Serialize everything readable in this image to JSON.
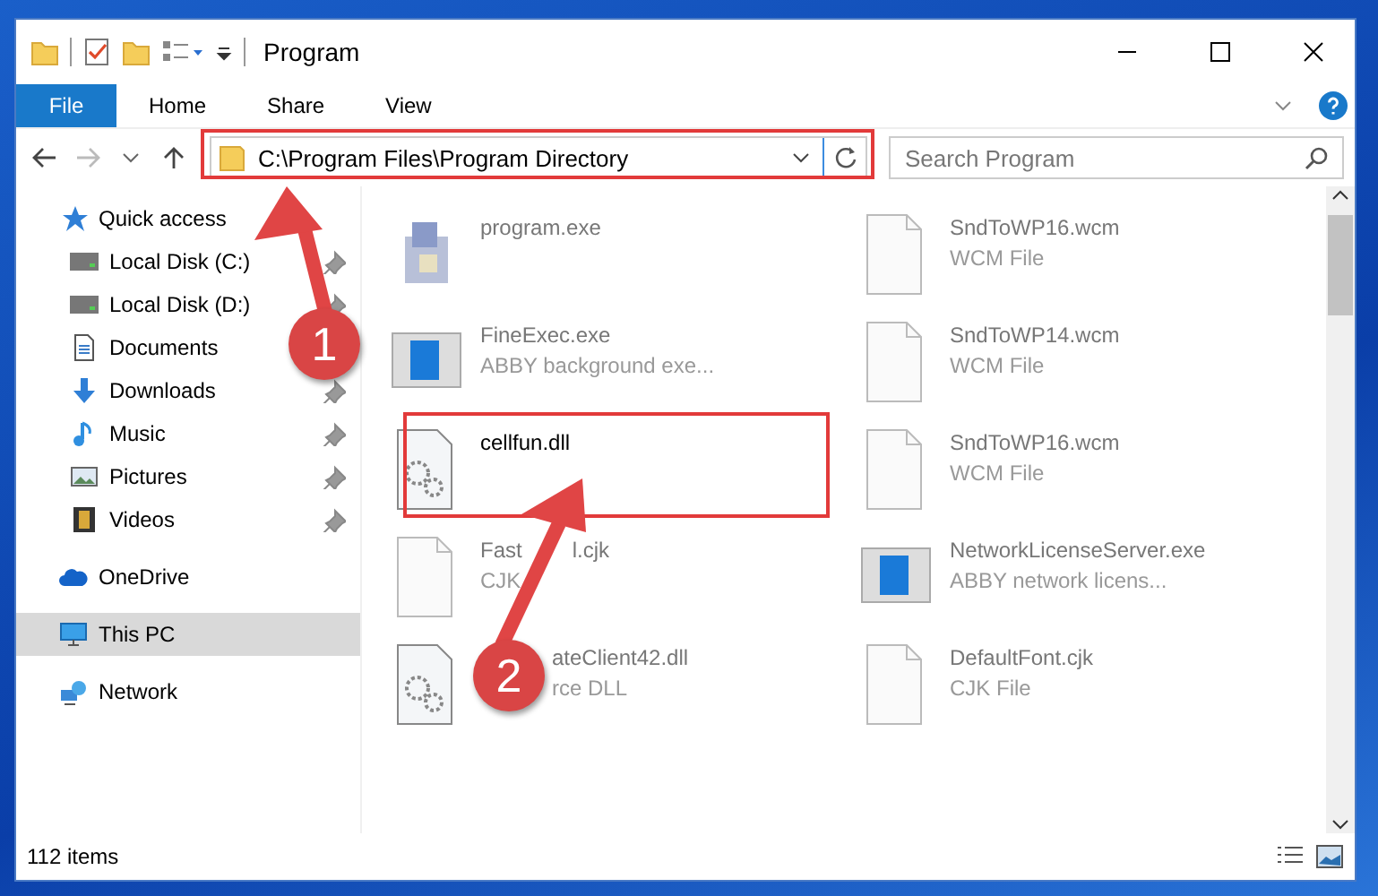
{
  "window": {
    "title": "Program"
  },
  "ribbon_tabs": [
    {
      "label": "File",
      "kind": "file"
    },
    {
      "label": "Home",
      "kind": "tab"
    },
    {
      "label": "Share",
      "kind": "tab"
    },
    {
      "label": "View",
      "kind": "tab"
    }
  ],
  "address": {
    "path": "C:\\Program Files\\Program Directory"
  },
  "search": {
    "placeholder": "Search Program"
  },
  "nav": [
    {
      "label": "Quick access",
      "kind": "star",
      "selected": false,
      "children": [
        {
          "label": "Local Disk (C:)",
          "kind": "drive",
          "pinned": true
        },
        {
          "label": "Local Disk (D:)",
          "kind": "drive",
          "pinned": true
        },
        {
          "label": "Documents",
          "kind": "document",
          "pinned": false
        },
        {
          "label": "Downloads",
          "kind": "download",
          "pinned": true
        },
        {
          "label": "Music",
          "kind": "music",
          "pinned": true
        },
        {
          "label": "Pictures",
          "kind": "picture",
          "pinned": true
        },
        {
          "label": "Videos",
          "kind": "video",
          "pinned": true
        }
      ]
    },
    {
      "label": "OneDrive",
      "kind": "cloud",
      "selected": false
    },
    {
      "label": "This PC",
      "kind": "pc",
      "selected": true
    },
    {
      "label": "Network",
      "kind": "network",
      "selected": false
    }
  ],
  "files": [
    {
      "name": "program.exe",
      "kind": "exe",
      "blurred": true
    },
    {
      "name": "FineExec.exe",
      "type": "ABBY background exe...",
      "kind": "app",
      "blurred": true
    },
    {
      "name": "cellfun.dll",
      "kind": "dll",
      "blurred": false
    },
    {
      "name": "Fast",
      "name_tail": "l.cjk",
      "type": "CJK",
      "kind": "file",
      "blurred": true
    },
    {
      "name": "ateClient42.dll",
      "type": "rce DLL",
      "kind": "dll",
      "blurred": true,
      "covered": true
    },
    {
      "name": "SndToWP16.wcm",
      "type": "WCM File",
      "kind": "file",
      "blurred": true
    },
    {
      "name": "SndToWP14.wcm",
      "type": "WCM File",
      "kind": "file",
      "blurred": true
    },
    {
      "name": "SndToWP16.wcm",
      "type": "WCM File",
      "kind": "file",
      "blurred": true
    },
    {
      "name": "NetworkLicenseServer.exe",
      "type": "ABBY network licens...",
      "kind": "app",
      "blurred": true
    },
    {
      "name": "DefaultFont.cjk",
      "type": "CJK File",
      "kind": "file",
      "blurred": true
    }
  ],
  "status_bar": {
    "item_count": "112 items"
  },
  "callouts": [
    {
      "number": "1"
    },
    {
      "number": "2"
    }
  ]
}
